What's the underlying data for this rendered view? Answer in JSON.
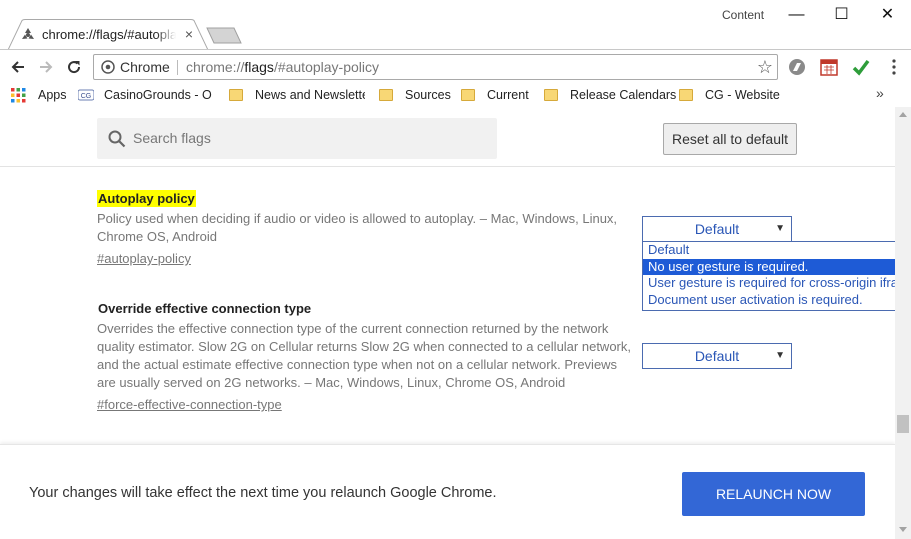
{
  "window": {
    "profile_name": "Content",
    "minimize_glyph": "—",
    "maximize_glyph": "☐",
    "close_glyph": "✕"
  },
  "tab": {
    "title": "chrome://flags/#autoplay-policy",
    "close_glyph": "×"
  },
  "omnibox": {
    "chip_label": "Chrome",
    "url_prefix": "chrome://",
    "url_host": "flags",
    "url_rest": "/#autoplay-policy",
    "star_glyph": "☆"
  },
  "bookmarks": {
    "apps_label": "Apps",
    "items": [
      {
        "label": "CasinoGrounds - On",
        "icon": "casinogrounds-icon"
      },
      {
        "label": "News and Newslette",
        "icon": "folder-icon"
      },
      {
        "label": "Sources",
        "icon": "folder-icon"
      },
      {
        "label": "Current",
        "icon": "folder-icon"
      },
      {
        "label": "Release Calendars",
        "icon": "folder-icon"
      },
      {
        "label": "CG - Website",
        "icon": "folder-icon"
      }
    ],
    "overflow_glyph": "»"
  },
  "flags_page": {
    "search_placeholder": "Search flags",
    "reset_label": "Reset all to default",
    "flags": [
      {
        "title": "Autoplay policy",
        "description": "Policy used when deciding if audio or video is allowed to autoplay. – Mac, Windows, Linux, Chrome OS, Android",
        "link": "#autoplay-policy",
        "selected": "Default",
        "options": [
          "Default",
          "No user gesture is required.",
          "User gesture is required for cross-origin iframes.",
          "Document user activation is required."
        ]
      },
      {
        "title": "Override effective connection type",
        "description": "Overrides the effective connection type of the current connection returned by the network quality estimator. Slow 2G on Cellular returns Slow 2G when connected to a cellular network, and the actual estimate effective connection type when not on a cellular network. Previews are usually served on 2G networks. – Mac, Windows, Linux, Chrome OS, Android",
        "link": "#force-effective-connection-type",
        "selected": "Default"
      }
    ],
    "footer_text": "Your changes will take effect the next time you relaunch Google Chrome.",
    "relaunch_label": "RELAUNCH NOW"
  },
  "colors": {
    "highlight": "#ffff00",
    "select_text": "#2a56b6",
    "option_selected_bg": "#1e5bd6",
    "relaunch_bg": "#3367d6"
  }
}
